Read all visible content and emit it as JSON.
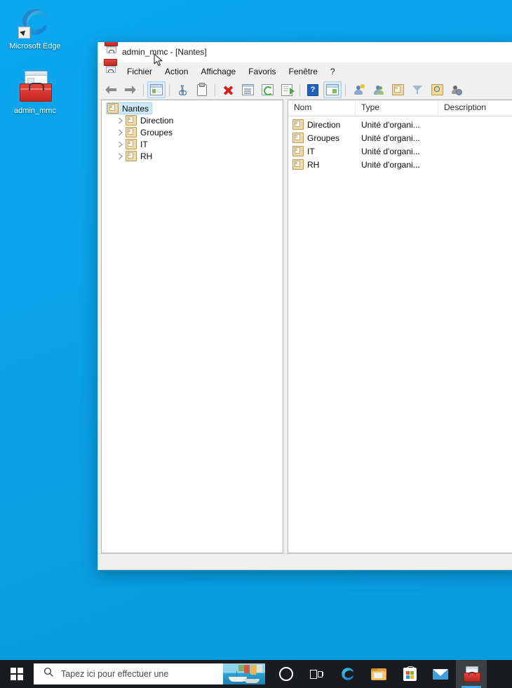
{
  "desktop": {
    "background_color": "#0aa3e9",
    "icons": [
      {
        "name": "microsoft-edge",
        "label": "Microsoft Edge",
        "icon": "edge-icon",
        "shortcut": true
      },
      {
        "name": "admin-mmc",
        "label": "admin_mmc",
        "icon": "toolbox-icon",
        "shortcut": false
      }
    ]
  },
  "window": {
    "title": "admin_mmc - [Nantes]",
    "title_icon": "toolbox-icon",
    "menu_icon": "toolbox-icon",
    "menu": [
      {
        "name": "fichier",
        "label": "Fichier"
      },
      {
        "name": "action",
        "label": "Action"
      },
      {
        "name": "affichage",
        "label": "Affichage"
      },
      {
        "name": "favoris",
        "label": "Favoris"
      },
      {
        "name": "fenetre",
        "label": "Fenêtre"
      },
      {
        "name": "aide",
        "label": "?"
      }
    ],
    "toolbar": [
      {
        "name": "back-button",
        "icon": "arrow-left-icon",
        "pressed": false
      },
      {
        "name": "forward-button",
        "icon": "arrow-right-icon",
        "pressed": false
      },
      {
        "sep": true
      },
      {
        "name": "show-hide-console-tree-button",
        "icon": "console-tree-icon",
        "pressed": true
      },
      {
        "sep": true
      },
      {
        "name": "cut-button",
        "icon": "scissors-icon",
        "pressed": false
      },
      {
        "name": "paste-button",
        "icon": "clipboard-icon",
        "pressed": false
      },
      {
        "sep": true
      },
      {
        "name": "delete-button",
        "icon": "red-x-icon",
        "pressed": false
      },
      {
        "name": "properties-button",
        "icon": "properties-icon",
        "pressed": false
      },
      {
        "name": "refresh-button",
        "icon": "refresh-icon",
        "pressed": false
      },
      {
        "name": "export-list-button",
        "icon": "export-icon",
        "pressed": false
      },
      {
        "sep": true
      },
      {
        "name": "help-button",
        "icon": "help-icon",
        "pressed": false
      },
      {
        "name": "show-hide-action-pane-button",
        "icon": "action-pane-icon",
        "pressed": false
      },
      {
        "sep": true
      },
      {
        "name": "new-user-button",
        "icon": "new-user-icon",
        "pressed": false
      },
      {
        "name": "new-group-button",
        "icon": "new-group-icon",
        "pressed": false
      },
      {
        "name": "new-organizational-unit-button",
        "icon": "new-ou-icon",
        "pressed": false
      },
      {
        "name": "filter-button",
        "icon": "filter-icon",
        "pressed": false
      },
      {
        "name": "find-button",
        "icon": "find-icon",
        "pressed": false
      },
      {
        "name": "delegate-control-button",
        "icon": "user-gear-icon",
        "pressed": false
      }
    ],
    "tree": {
      "root": {
        "name": "nantes",
        "label": "Nantes",
        "icon": "ou-icon",
        "selected": true,
        "expandable": false
      },
      "children": [
        {
          "name": "direction",
          "label": "Direction",
          "icon": "ou-icon",
          "expandable": true,
          "expanded": false
        },
        {
          "name": "groupes",
          "label": "Groupes",
          "icon": "ou-icon",
          "expandable": true,
          "expanded": false
        },
        {
          "name": "it",
          "label": "IT",
          "icon": "ou-icon",
          "expandable": true,
          "expanded": false
        },
        {
          "name": "rh",
          "label": "RH",
          "icon": "ou-icon",
          "expandable": true,
          "expanded": false
        }
      ]
    },
    "list": {
      "columns": [
        {
          "name": "column-nom",
          "label": "Nom"
        },
        {
          "name": "column-type",
          "label": "Type"
        },
        {
          "name": "column-description",
          "label": "Description"
        }
      ],
      "rows": [
        {
          "name": "Direction",
          "type": "Unité d'organi...",
          "description": "",
          "icon": "ou-icon"
        },
        {
          "name": "Groupes",
          "type": "Unité d'organi...",
          "description": "",
          "icon": "ou-icon"
        },
        {
          "name": "IT",
          "type": "Unité d'organi...",
          "description": "",
          "icon": "ou-icon"
        },
        {
          "name": "RH",
          "type": "Unité d'organi...",
          "description": "",
          "icon": "ou-icon"
        }
      ]
    },
    "statusbar": {
      "text": ""
    }
  },
  "taskbar": {
    "start": {
      "name": "start-button",
      "icon": "windows-logo-icon"
    },
    "search": {
      "name": "search-input",
      "placeholder": "Tapez ici pour effectuer une",
      "value": "",
      "icon": "search-icon"
    },
    "buttons": [
      {
        "name": "cortana-button",
        "icon": "cortana-circle-icon",
        "active": false
      },
      {
        "name": "task-view-button",
        "icon": "task-view-icon",
        "active": false
      },
      {
        "name": "edge-taskbar-button",
        "icon": "edge-icon",
        "active": false
      },
      {
        "name": "file-explorer-taskbar-button",
        "icon": "folder-icon",
        "active": false
      },
      {
        "name": "microsoft-store-taskbar-button",
        "icon": "store-icon",
        "active": false
      },
      {
        "name": "mail-taskbar-button",
        "icon": "mail-icon",
        "active": false
      },
      {
        "name": "admin-mmc-taskbar-button",
        "icon": "toolbox-icon",
        "active": true
      }
    ]
  }
}
